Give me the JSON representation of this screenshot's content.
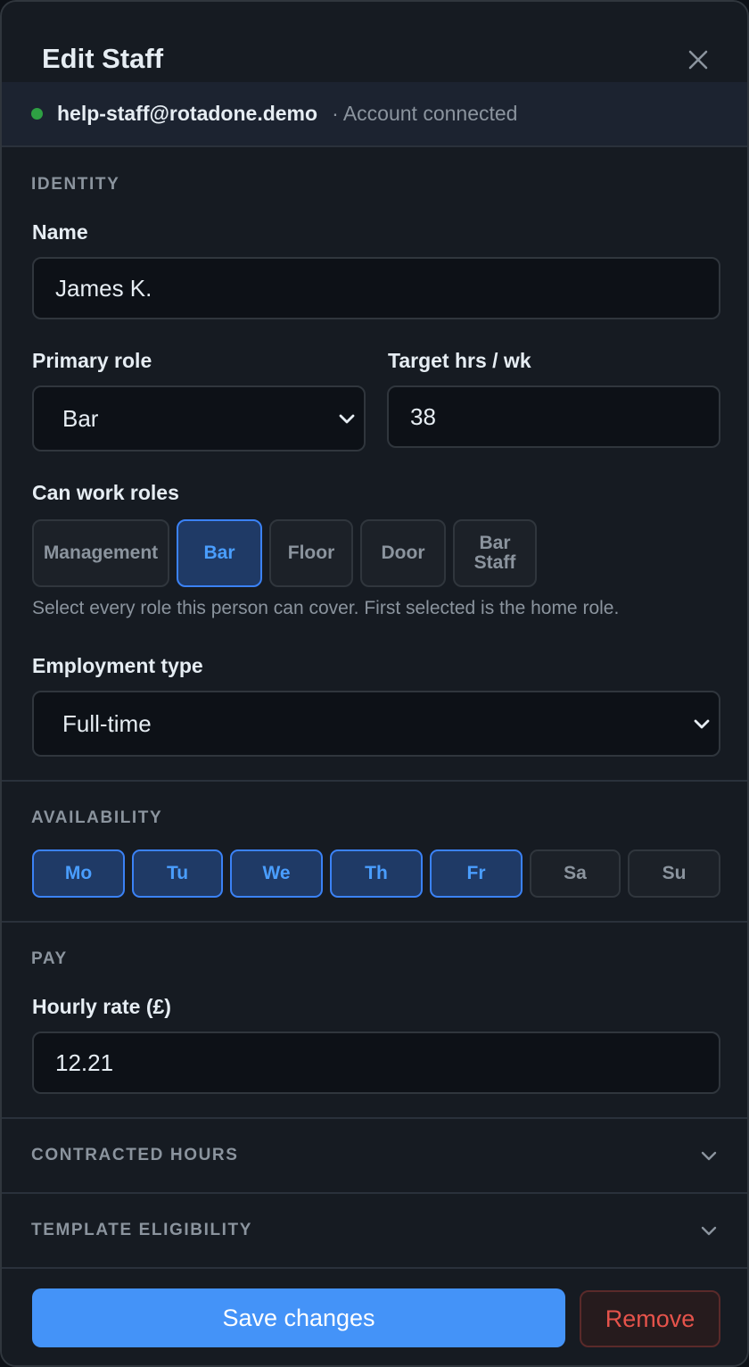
{
  "modal": {
    "title": "Edit Staff"
  },
  "account": {
    "email": "help-staff@rotadone.demo",
    "status": "· Account connected",
    "status_color": "#2ea043"
  },
  "identity": {
    "section_label": "IDENTITY",
    "name_label": "Name",
    "name_value": "James K.",
    "primary_role_label": "Primary role",
    "primary_role_value": "Bar",
    "target_hours_label": "Target hrs / wk",
    "target_hours_value": "38",
    "can_work_label": "Can work roles",
    "roles": [
      {
        "label": "Management",
        "selected": false
      },
      {
        "label": "Bar",
        "selected": true
      },
      {
        "label": "Floor",
        "selected": false
      },
      {
        "label": "Door",
        "selected": false
      },
      {
        "label": "Bar Staff",
        "selected": false
      }
    ],
    "roles_hint": "Select every role this person can cover. First selected is the home role.",
    "employment_label": "Employment type",
    "employment_value": "Full-time"
  },
  "availability": {
    "section_label": "AVAILABILITY",
    "days": [
      {
        "label": "Mo",
        "selected": true
      },
      {
        "label": "Tu",
        "selected": true
      },
      {
        "label": "We",
        "selected": true
      },
      {
        "label": "Th",
        "selected": true
      },
      {
        "label": "Fr",
        "selected": true
      },
      {
        "label": "Sa",
        "selected": false
      },
      {
        "label": "Su",
        "selected": false
      }
    ]
  },
  "pay": {
    "section_label": "PAY",
    "rate_label": "Hourly rate (£)",
    "rate_value": "12.21"
  },
  "collapsibles": {
    "contracted": "CONTRACTED HOURS",
    "template": "TEMPLATE ELIGIBILITY"
  },
  "footer": {
    "save_label": "Save changes",
    "remove_label": "Remove"
  },
  "colors": {
    "accent": "#4493f8",
    "danger": "#e5534b",
    "selected_chip": "#1f3a66"
  }
}
